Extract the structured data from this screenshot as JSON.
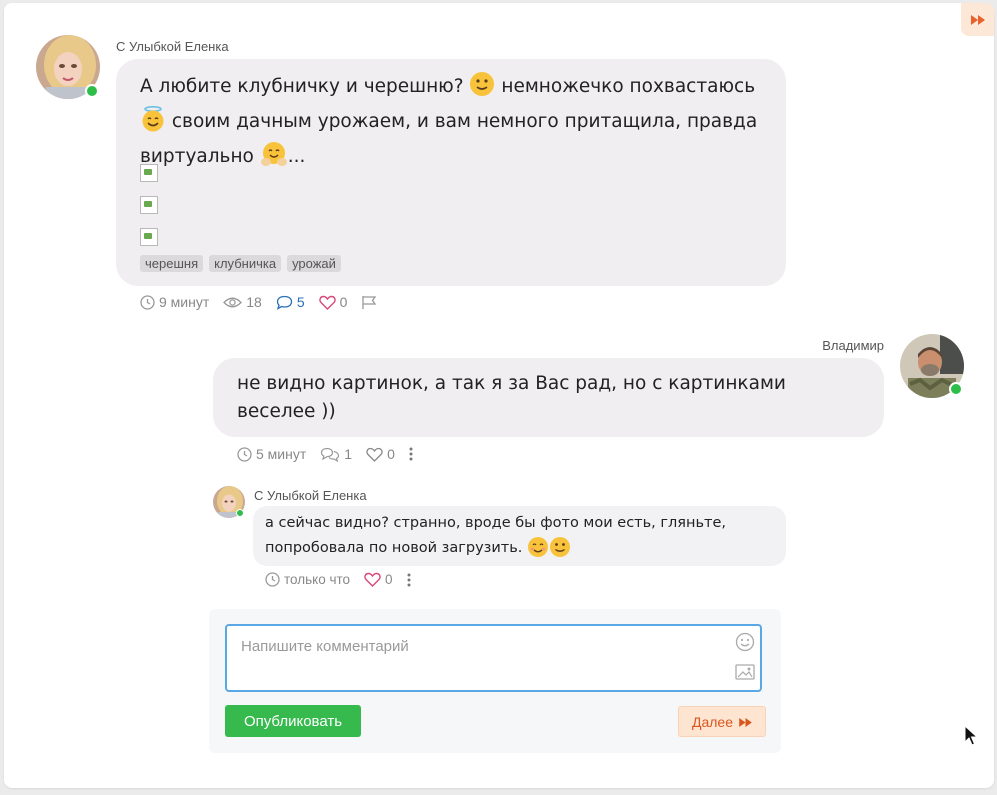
{
  "post": {
    "author": "С Улыбкой Еленка",
    "text_part1": "А любите клубничку и черешню?",
    "text_part2": "немножечко похвастаюсь",
    "text_part3": "своим дачным урожаем, и вам немного притащила, правда",
    "text_part4": "виртуально",
    "text_part5": "...",
    "tags": [
      "черешня",
      "клубничка",
      "урожай"
    ],
    "meta": {
      "time": "9 минут",
      "views": "18",
      "comments": "5",
      "likes": "0"
    }
  },
  "reply": {
    "author": "Владимир",
    "text": "не видно картинок, а так я за Вас рад, но с картинками веселее ))",
    "meta": {
      "time": "5 минут",
      "replies": "1",
      "likes": "0"
    }
  },
  "subreply": {
    "author": "С Улыбкой Еленка",
    "text": "а сейчас видно? странно, вроде бы фото мои есть, гляньте, попробовала по новой загрузить.",
    "meta": {
      "time": "только что",
      "likes": "0"
    }
  },
  "composer": {
    "placeholder": "Напишите комментарий",
    "publish_label": "Опубликовать",
    "next_label": "Далее"
  },
  "colors": {
    "accent_green": "#36b94d",
    "online": "#2dbe4a",
    "link_blue": "#2a6fb8",
    "heart": "#d9467a",
    "next_orange": "#d9571f"
  },
  "icons": {
    "corner": "fast-forward-icon",
    "clock": "clock-icon",
    "eye": "eye-icon",
    "comment": "comment-icon",
    "heart": "heart-icon",
    "flag": "flag-icon",
    "more": "more-vertical-icon",
    "emoji": "smiley-icon",
    "image": "image-icon"
  }
}
